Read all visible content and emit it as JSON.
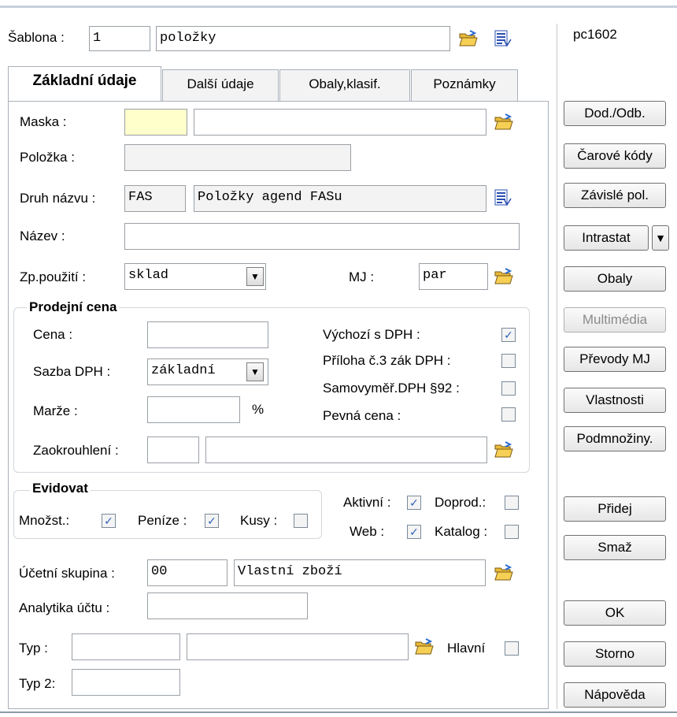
{
  "window": {
    "computer": "pc1602"
  },
  "template": {
    "label": "Šablona :",
    "code": "1",
    "name": "položky"
  },
  "tabs": [
    {
      "label": "Základní údaje"
    },
    {
      "label": "Další údaje"
    },
    {
      "label": "Obaly,klasif."
    },
    {
      "label": "Poznámky"
    }
  ],
  "form": {
    "maska_label": "Maska :",
    "maska_value": "",
    "maska_text": "",
    "polozka_label": "Položka :",
    "polozka_value": "",
    "druh_label": "Druh názvu :",
    "druh_code": "FAS",
    "druh_name": "Položky agend FASu",
    "nazev_label": "Název :",
    "nazev_value": "",
    "zp_label": "Zp.použití :",
    "zp_value": "sklad",
    "mj_label": "MJ :",
    "mj_value": "par"
  },
  "price": {
    "title": "Prodejní cena",
    "cena_label": "Cena :",
    "cena_value": "",
    "sazba_label": "Sazba DPH :",
    "sazba_value": "základní",
    "marze_label": "Marže :",
    "marze_value": "",
    "pct": "%",
    "zaokr_label": "Zaokrouhlení :",
    "zaokr_code": "",
    "zaokr_text": "",
    "vychozi_label": "Výchozí s DPH :",
    "vychozi_checked": true,
    "priloha_label": "Příloha č.3 zák DPH :",
    "priloha_checked": false,
    "samovymer_label": "Samovyměř.DPH §92 :",
    "samovymer_checked": false,
    "pevna_label": "Pevná cena :",
    "pevna_checked": false
  },
  "evid": {
    "title": "Evidovat",
    "mnozst_label": "Množst.:",
    "mnozst_checked": true,
    "penize_label": "Peníze :",
    "penize_checked": true,
    "kusy_label": "Kusy :",
    "kusy_checked": false,
    "aktivni_label": "Aktivní :",
    "aktivni_checked": true,
    "doprod_label": "Doprod.:",
    "doprod_checked": false,
    "web_label": "Web :",
    "web_checked": true,
    "katalog_label": "Katalog :",
    "katalog_checked": false
  },
  "account": {
    "skupina_label": "Účetní skupina :",
    "skupina_code": "00",
    "skupina_name": "Vlastní zboží",
    "analytika_label": "Analytika účtu :",
    "analytika_value": "",
    "typ_label": "Typ :",
    "typ_code": "",
    "typ_text": "",
    "hlavni_label": "Hlavní",
    "hlavni_checked": false,
    "typ2_label": "Typ 2:",
    "typ2_value": ""
  },
  "buttons": {
    "dod": "Dod./Odb.",
    "carove": "Čarové kódy",
    "zavisle": "Závislé pol.",
    "intrastat": "Intrastat",
    "obaly": "Obaly",
    "multimedia": "Multimédia",
    "prevody": "Převody MJ",
    "vlastnosti": "Vlastnosti",
    "podmnoziny": "Podmnožiny.",
    "pridej": "Přidej",
    "smaz": "Smaž",
    "ok": "OK",
    "storno": "Storno",
    "napoveda": "Nápověda"
  },
  "icons": {
    "folder": "folder-open-icon",
    "list": "list-lookup-icon"
  },
  "colors": {
    "check": "#2c5fb5",
    "required_field": "#ffffcc"
  }
}
